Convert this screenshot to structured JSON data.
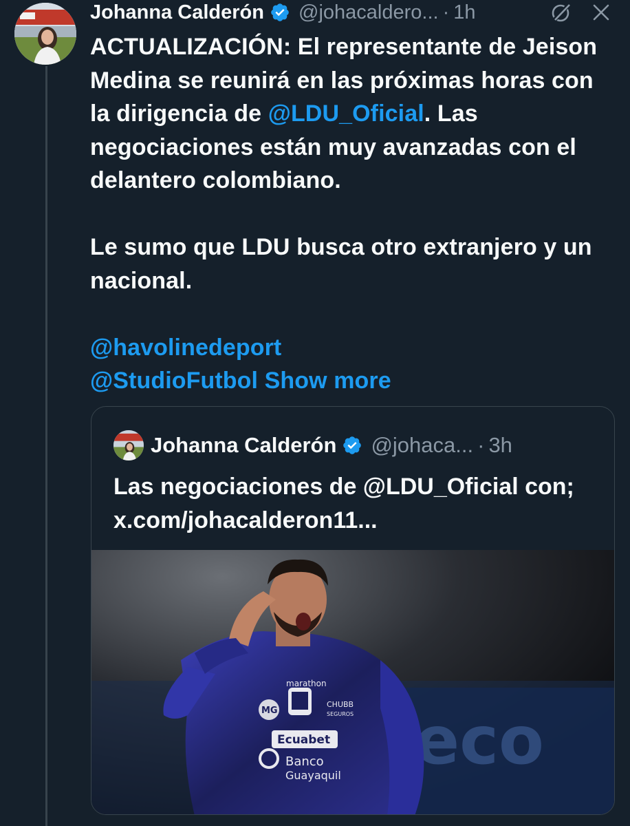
{
  "tweet": {
    "author": {
      "name": "Johanna Calderón",
      "handle": "@johacaldero...",
      "verified": true,
      "avatar_icon": "profile-photo"
    },
    "separator": "·",
    "time": "1h",
    "icons": [
      "grok-icon",
      "close-icon"
    ],
    "body": {
      "line1_prefix": "ACTUALIZACIÓN: El representante de Jeison Medina se reunirá en las próximas horas con la dirigencia de ",
      "mention1": "@LDU_Oficial",
      "line1_suffix": ". Las negociaciones están muy avanzadas con el delantero colombiano.",
      "para2": "Le sumo que LDU busca otro extranjero y un nacional.",
      "mention2": "@havolinedeport",
      "mention3": "@StudioFutbol",
      "show_more": "Show more"
    }
  },
  "quoted_tweet": {
    "author": {
      "name": "Johanna Calderón",
      "handle": "@johaca...",
      "verified": true,
      "avatar_icon": "profile-photo"
    },
    "separator": "·",
    "time": "3h",
    "text": "Las negociaciones de @LDU_Oficial con; x.com/johacalderon11...",
    "media": {
      "type": "photo",
      "shirt_texts": [
        "marathon",
        "MG",
        "CHUBB",
        "SEGUROS",
        "Ecuabet",
        "Banco",
        "Guayaquil"
      ],
      "background_text": "eco"
    }
  },
  "colors": {
    "background": "#15202b",
    "text": "#f7f9f9",
    "secondary": "#8b98a5",
    "link": "#1d9bf0",
    "border": "#38444d",
    "verified": "#1d9bf0"
  }
}
